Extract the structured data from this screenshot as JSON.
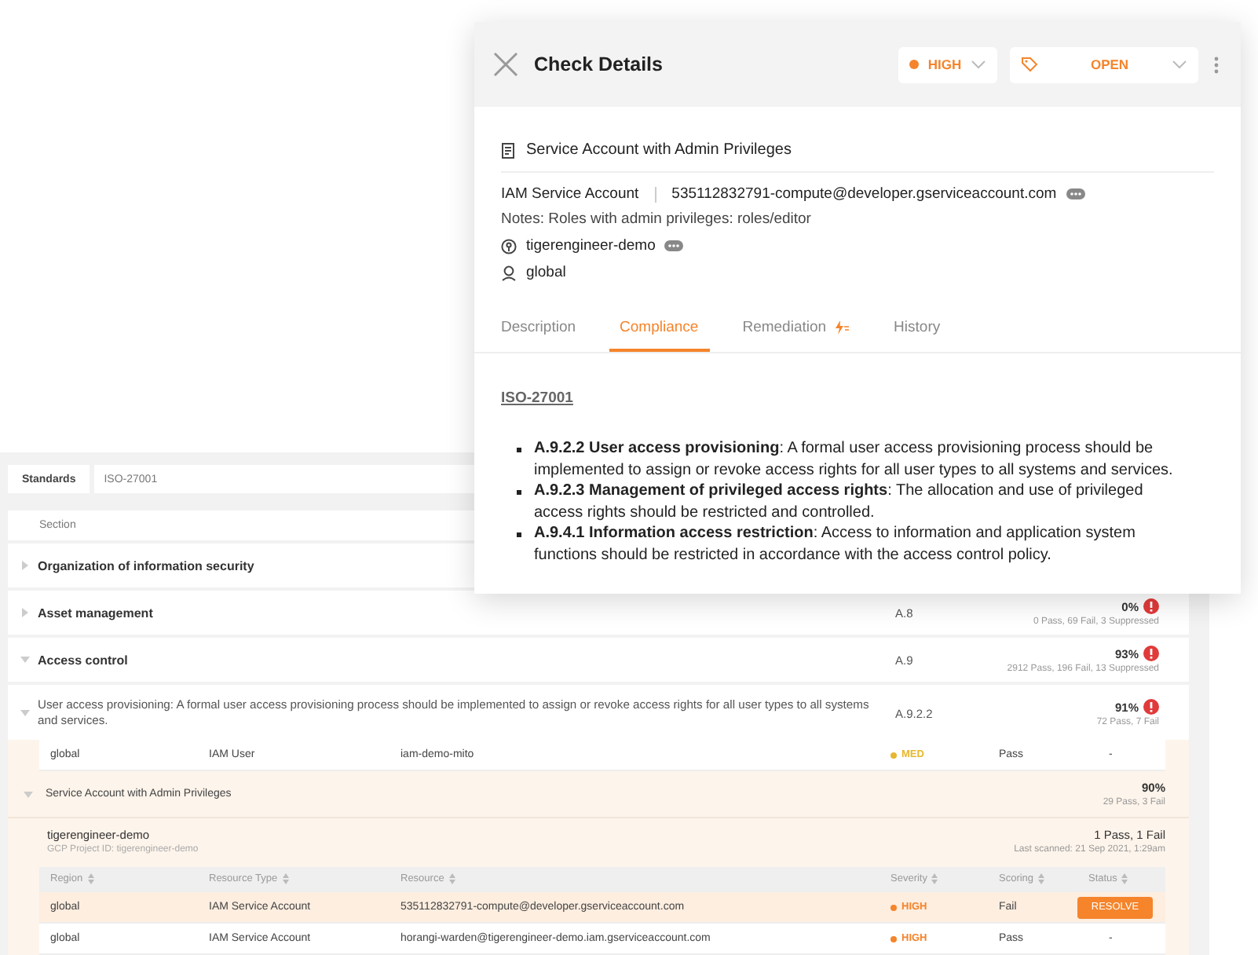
{
  "standards_filter": {
    "label": "Standards",
    "value": "ISO-27001"
  },
  "sections": {
    "column": "Section",
    "rows": [
      {
        "title": "Organization of information security",
        "expanded": false
      },
      {
        "title": "Asset management",
        "expanded": false,
        "code": "A.8",
        "percent": "0%",
        "alert": true,
        "summary": "0 Pass, 69 Fail, 3 Suppressed"
      },
      {
        "title": "Access control",
        "expanded": true,
        "code": "A.9",
        "percent": "93%",
        "alert": true,
        "summary": "2912 Pass, 196 Fail, 13 Suppressed"
      }
    ]
  },
  "requirement": {
    "title": "User access provisioning: A formal user access provisioning process should be implemented to assign or revoke access rights for all user types to all systems and services.",
    "expanded": true,
    "code": "A.9.2.2",
    "percent": "91%",
    "alert": true,
    "summary": "72 Pass, 7 Fail"
  },
  "previous_rows": [
    {
      "region": "global",
      "type": "IAM User",
      "resource": "iam-demo-mito",
      "severity": {
        "label": "MED",
        "color": "#e6b830"
      },
      "scoring": "Pass",
      "status": {
        "kind": "text",
        "label": "-"
      },
      "selected": false
    }
  ],
  "check": {
    "title": "Service Account with Admin Privileges",
    "expanded": true,
    "percent": "90%",
    "summary": "29 Pass, 3 Fail",
    "project": "tigerengineer-demo",
    "project_id": "GCP Project ID: tigerengineer-demo",
    "result": "1 Pass, 1 Fail",
    "last_scanned": "Last scanned: 21 Sep 2021, 1:29am",
    "columns": [
      "Region",
      "Resource Type",
      "Resource",
      "Severity",
      "Scoring",
      "Status"
    ],
    "rows": [
      {
        "region": "global",
        "type": "IAM Service Account",
        "resource": "535112832791-compute@developer.gserviceaccount.com",
        "severity": {
          "label": "HIGH",
          "color": "#f5842b"
        },
        "scoring": "Fail",
        "status": {
          "kind": "button",
          "label": "RESOLVE"
        },
        "selected": true
      },
      {
        "region": "global",
        "type": "IAM Service Account",
        "resource": "horangi-warden@tigerengineer-demo.iam.gserviceaccount.com",
        "severity": {
          "label": "HIGH",
          "color": "#f5842b"
        },
        "scoring": "Pass",
        "status": {
          "kind": "text",
          "label": "-"
        },
        "selected": false
      }
    ]
  },
  "detail": {
    "title": "Check Details",
    "severity": {
      "label": "HIGH",
      "color": "#f5842b"
    },
    "status": {
      "label": "OPEN"
    },
    "check_name": "Service Account with Admin Privileges",
    "resource_type": "IAM Service Account",
    "resource": "535112832791-compute@developer.gserviceaccount.com",
    "notes": "Notes: Roles with admin privileges: roles/editor",
    "project": "tigerengineer-demo",
    "region": "global",
    "tabs": [
      {
        "label": "Description",
        "selected": false,
        "kind": "plain"
      },
      {
        "label": "Compliance",
        "selected": true,
        "kind": "plain"
      },
      {
        "label": "Remediation",
        "selected": false,
        "kind": "bolt"
      },
      {
        "label": "History",
        "selected": false,
        "kind": "plain"
      }
    ],
    "standard": "ISO-27001",
    "requirements": [
      "**A.9.2.2 User access provisioning**: A formal user access provisioning process should be implemented to assign or revoke access rights for all user types to all systems and services.",
      "**A.9.2.3 Management of privileged access rights**: The allocation and use of privileged access rights should be restricted and controlled.",
      "**A.9.4.1 Information access restriction**: Access to information and application system functions should be restricted in accordance with the access control policy."
    ]
  }
}
